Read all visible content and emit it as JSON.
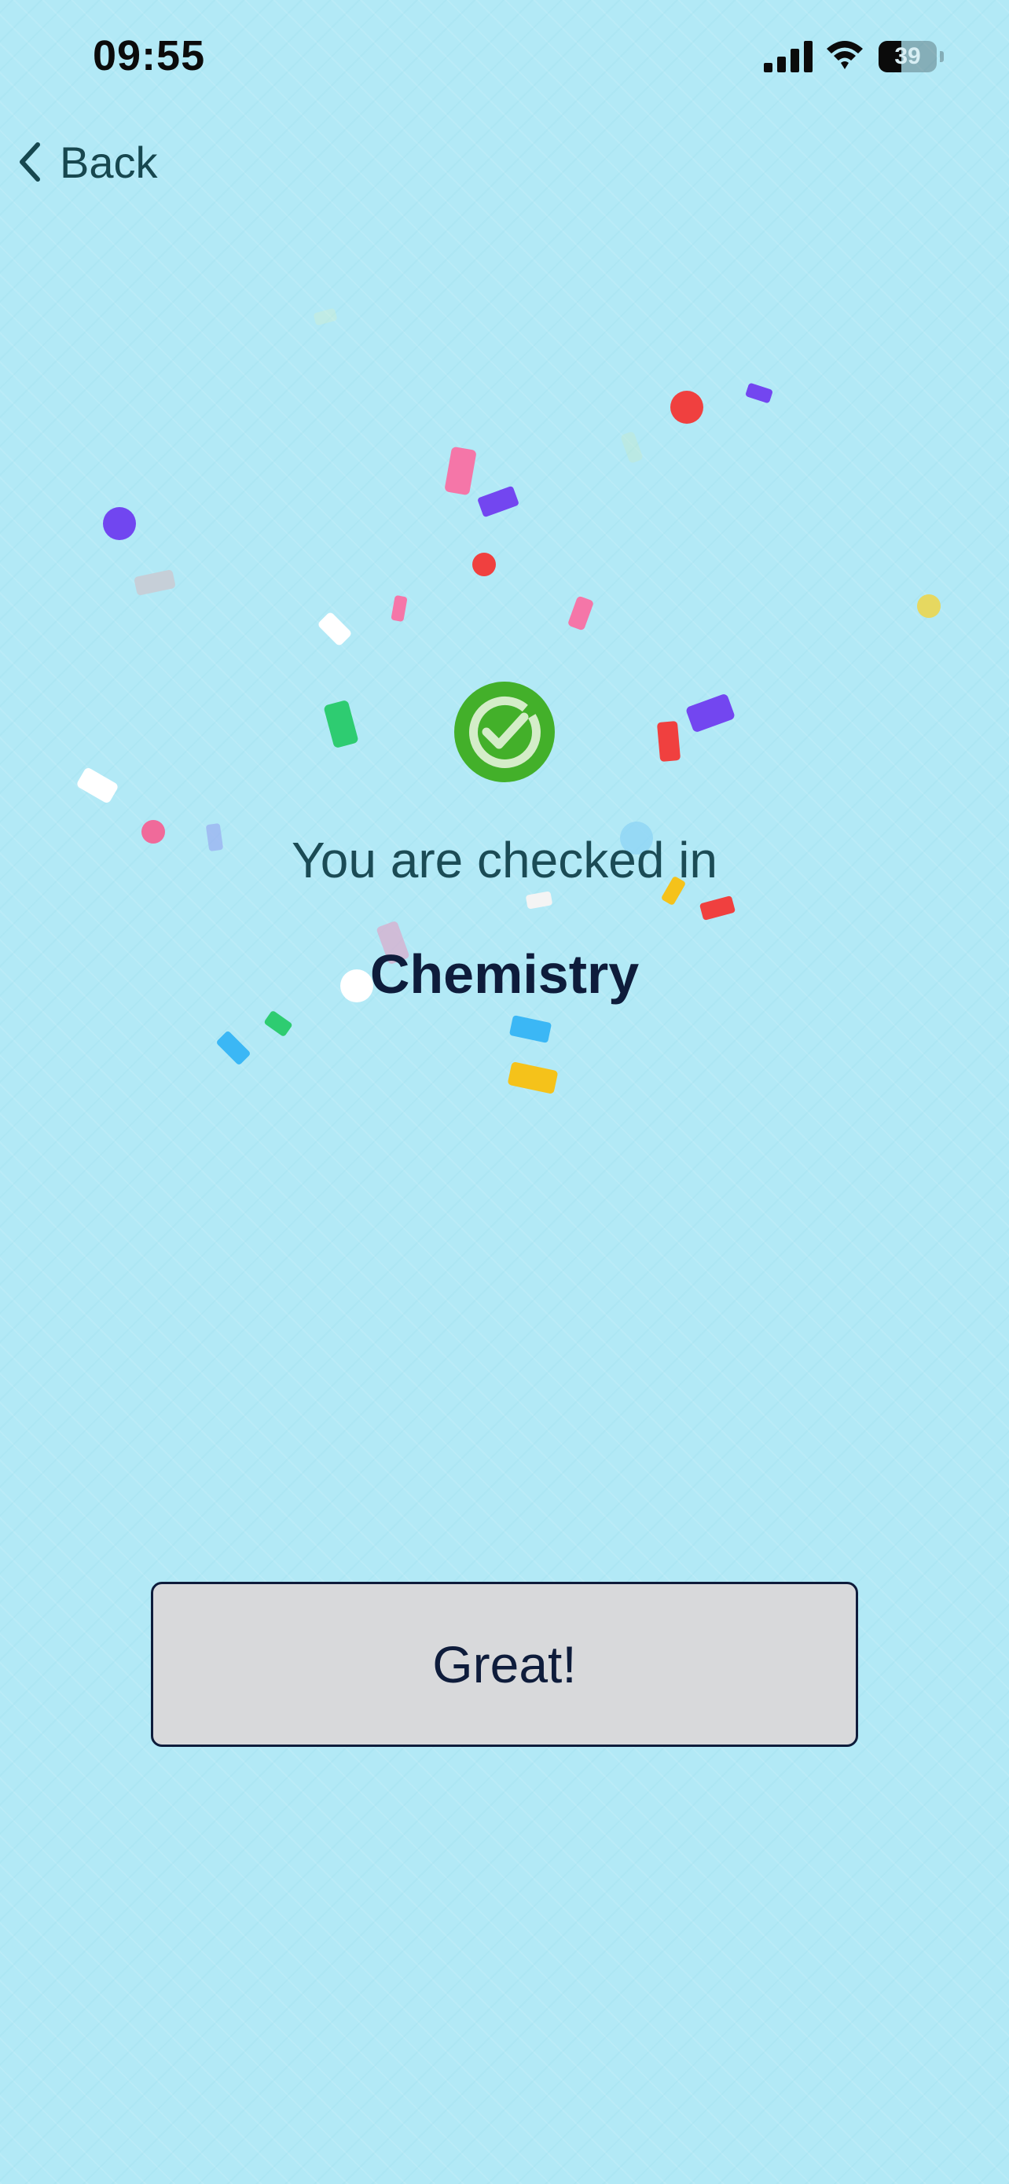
{
  "status_bar": {
    "time": "09:55",
    "battery_level": "39",
    "battery_fraction": 0.39,
    "signal_bars": 4,
    "wifi": "connected"
  },
  "nav": {
    "back_label": "Back",
    "back_icon": "chevron-left-icon"
  },
  "confirmation": {
    "icon": "check-circle-icon",
    "message": "You are checked in",
    "class_name": "Chemistry"
  },
  "actions": {
    "confirm_label": "Great!"
  },
  "colors": {
    "background": "#b2e9f6",
    "success_green": "#43b02a",
    "heading_text": "#0e1c3b",
    "body_text": "#1b4b55",
    "button_fill": "#d8d9db"
  }
}
